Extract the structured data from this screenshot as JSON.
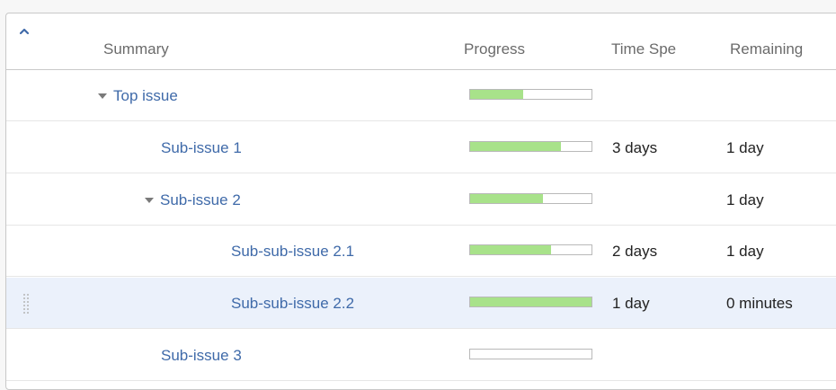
{
  "header": {
    "columns": {
      "summary": "Summary",
      "progress": "Progress",
      "time_spent": "Time Spe",
      "remaining": "Remaining"
    }
  },
  "rows": [
    {
      "summary": "Top issue",
      "level": 0,
      "expandable": true,
      "progress": 0.44,
      "time_spent": "",
      "remaining": "",
      "selected": false
    },
    {
      "summary": "Sub-issue 1",
      "level": 1,
      "expandable": false,
      "progress": 0.75,
      "time_spent": "3 days",
      "remaining": "1 day",
      "selected": false
    },
    {
      "summary": "Sub-issue 2",
      "level": 1,
      "expandable": true,
      "progress": 0.6,
      "time_spent": "",
      "remaining": "1 day",
      "selected": false
    },
    {
      "summary": "Sub-sub-issue 2.1",
      "level": 2,
      "expandable": false,
      "progress": 0.67,
      "time_spent": "2 days",
      "remaining": "1 day",
      "selected": false
    },
    {
      "summary": "Sub-sub-issue 2.2",
      "level": 2,
      "expandable": false,
      "progress": 1.0,
      "time_spent": "1 day",
      "remaining": "0 minutes",
      "selected": true
    },
    {
      "summary": "Sub-issue 3",
      "level": 1,
      "expandable": false,
      "progress": 0.0,
      "time_spent": "",
      "remaining": "",
      "selected": false
    }
  ],
  "colors": {
    "link": "#3f6aa9",
    "progress_fill": "#a8e28a",
    "selected_row": "#ebf1fb"
  }
}
